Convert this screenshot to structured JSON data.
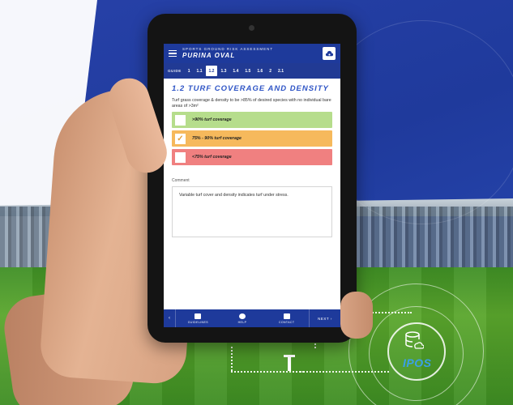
{
  "app": {
    "subtitle": "SPORTS GROUND RISK ASSESSMENT",
    "title": "PURINA OVAL",
    "cloud_icon": "cloud-settings-icon"
  },
  "tabs": {
    "guide_label": "GUIDE",
    "items": [
      "1",
      "1.1",
      "1.2",
      "1.3",
      "1.4",
      "1.5",
      "1.6",
      "2",
      "2.1"
    ],
    "active": "1.2"
  },
  "section": {
    "heading": "1.2 TURF COVERAGE AND DENSITY",
    "description": "Turf grass coverage & density to be >85% of desired species with no individual bare areas of >3m²"
  },
  "options": [
    {
      "label": ">90% turf coverage",
      "checked": false,
      "color": "#b6dd8c"
    },
    {
      "label": "75% - 90% turf coverage",
      "checked": true,
      "color": "#f6b95c"
    },
    {
      "label": "<75% turf coverage",
      "checked": false,
      "color": "#f08080"
    }
  ],
  "comment": {
    "label": "Comment",
    "value": "Variable turf cover and density indicates turf under stress."
  },
  "bottom_nav": {
    "prev": "‹",
    "guidelines": "GUIDELINES",
    "help": "HELP",
    "contact": "CONTACT",
    "next": "NEXT ›"
  },
  "brand": {
    "logo_text": "IPOS",
    "icon": "database-cloud-icon"
  },
  "colors": {
    "primary": "#1e3a9b",
    "heading": "#2f55c6",
    "brand_blue": "#3aa0e8"
  }
}
